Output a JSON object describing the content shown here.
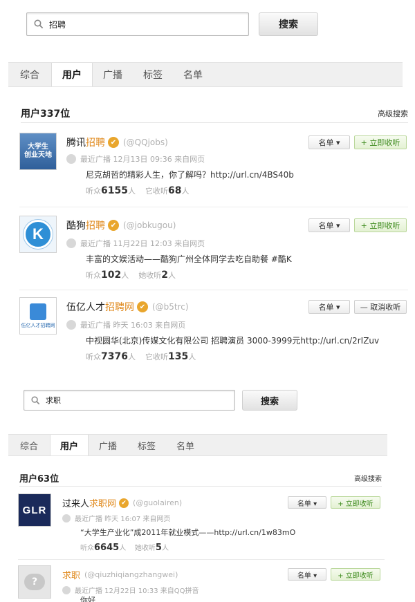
{
  "block1": {
    "search": {
      "query": "招聘",
      "button": "搜索"
    },
    "tabs": [
      "综合",
      "用户",
      "广播",
      "标签",
      "名单"
    ],
    "result_count": "用户337位",
    "advanced": "高级搜索",
    "users": [
      {
        "avatar_text": "大学生\n创业天地",
        "name_pre": "腾讯",
        "name_hl": "招聘",
        "name_post": "",
        "verified": "✔",
        "uid": "(@QQjobs)",
        "recent": "最近广播  12月13日  09:36 来自网页",
        "tweet": "尼克胡哲的精彩人生，你了解吗？http://url.cn/4BS40b",
        "listen_label": "听众",
        "listen_count": "6155",
        "listen_unit": "人",
        "heard_label": "它收听",
        "heard_count": "68",
        "heard_unit": "人",
        "list_btn": "名单 ▾",
        "action_btn": "+ 立即收听"
      },
      {
        "avatar_text": "K",
        "name_pre": "酷狗",
        "name_hl": "招聘",
        "name_post": "",
        "verified": "✔",
        "uid": "(@jobkugou)",
        "recent": "最近广播  11月22日  12:03 来自网页",
        "tweet": "丰富的文娱活动——酷狗广州全体同学去吃自助餐 #酷K",
        "listen_label": "听众",
        "listen_count": "102",
        "listen_unit": "人",
        "heard_label": "她收听",
        "heard_count": "2",
        "heard_unit": "人",
        "list_btn": "名单 ▾",
        "action_btn": "+ 立即收听"
      },
      {
        "avatar_text": "伍亿人才招聘网",
        "name_pre": "伍亿人才",
        "name_hl": "招聘网",
        "name_post": "",
        "verified": "✔",
        "uid": "(@b5trc)",
        "recent": "最近广播  昨天  16:03 来自网页",
        "tweet": "中视圆华(北京)传媒文化有限公司 招聘演员 3000-3999元http://url.cn/2rIZuv",
        "listen_label": "听众",
        "listen_count": "7376",
        "listen_unit": "人",
        "heard_label": "它收听",
        "heard_count": "135",
        "heard_unit": "人",
        "list_btn": "名单 ▾",
        "action_btn": "— 取消收听"
      }
    ]
  },
  "block2": {
    "search": {
      "query": "求职",
      "button": "搜索"
    },
    "tabs": [
      "综合",
      "用户",
      "广播",
      "标签",
      "名单"
    ],
    "result_count": "用户63位",
    "advanced": "高级搜索",
    "users": [
      {
        "avatar_text": "GLR",
        "name_pre": "过来人",
        "name_hl": "求职网",
        "name_post": "",
        "verified": "✔",
        "uid": "(@guolairen)",
        "recent": "最近广播  昨天  16:07 来自网页",
        "tweet": "“大学生产业化”成2011年就业模式——http://url.cn/1w83mO",
        "listen_label": "听众",
        "listen_count": "6645",
        "listen_unit": "人",
        "heard_label": "她收听",
        "heard_count": "5",
        "heard_unit": "人",
        "list_btn": "名单 ▾",
        "action_btn": "+ 立即收听"
      },
      {
        "avatar_text": "?",
        "name_pre": "",
        "name_hl": "求职",
        "name_post": "",
        "verified": "",
        "uid": "(@qiuzhiqiangzhangwei)",
        "recent": "最近广播  12月22日  10:33 来自QQ拼音",
        "tweet": "你好",
        "list_btn": "名单 ▾",
        "action_btn": "+ 立即收听"
      }
    ]
  },
  "colors": {
    "highlight": "#e08a1e",
    "verified": "#e9a62d",
    "follow_green": "#3c8a1c",
    "tab_bar": "#f0f0f0"
  }
}
